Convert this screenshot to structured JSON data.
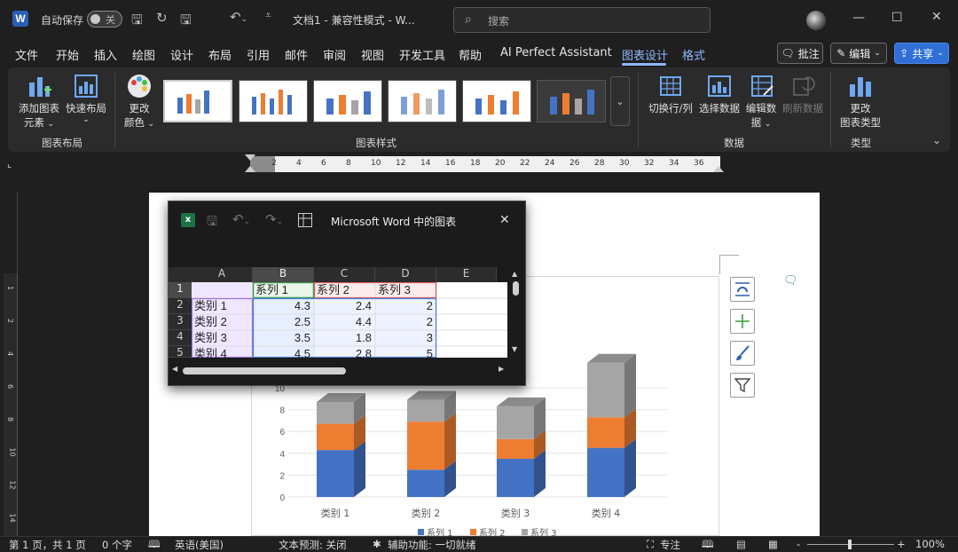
{
  "titlebar": {
    "autosave_label": "自动保存",
    "autosave_state": "关",
    "doc_title": "文档1",
    "separator": "-",
    "mode": "兼容性模式",
    "separator2": "-",
    "app": "W...",
    "search_placeholder": "搜索"
  },
  "tabs": [
    "文件",
    "开始",
    "插入",
    "绘图",
    "设计",
    "布局",
    "引用",
    "邮件",
    "审阅",
    "视图",
    "开发工具",
    "帮助",
    "AI Perfect Assistant",
    "图表设计",
    "格式"
  ],
  "right_buttons": {
    "comment": "批注",
    "edit": "编辑",
    "share": "共享"
  },
  "ribbon": {
    "add_element": [
      "添加图表",
      "元素"
    ],
    "quick_layout": "快速布局",
    "group_layout": "图表布局",
    "change_color": [
      "更改",
      "颜色"
    ],
    "group_styles": "图表样式",
    "switch_row_col": "切换行/列",
    "select_data": "选择数据",
    "edit_data": [
      "编辑数",
      "据"
    ],
    "refresh_data": "刷新数据",
    "group_data": "数据",
    "change_type": [
      "更改",
      "图表类型"
    ],
    "group_type": "类型"
  },
  "ruler_numbers": [
    "2",
    "4",
    "6",
    "8",
    "10",
    "12",
    "14",
    "16",
    "18",
    "20",
    "22",
    "24",
    "26",
    "28",
    "30",
    "32",
    "34",
    "36"
  ],
  "vruler_numbers": [
    "1",
    "2",
    "4",
    "6",
    "8",
    "10",
    "12",
    "14"
  ],
  "excel": {
    "title": "Microsoft Word 中的图表",
    "columns": [
      "A",
      "B",
      "C",
      "D",
      "E"
    ],
    "rows": [
      "1",
      "2",
      "3",
      "4",
      "5"
    ],
    "header_row": [
      "",
      "系列 1",
      "系列 2",
      "系列 3"
    ],
    "data": [
      [
        "类别 1",
        "4.3",
        "2.4",
        "2"
      ],
      [
        "类别 2",
        "2.5",
        "4.4",
        "2"
      ],
      [
        "类别 3",
        "3.5",
        "1.8",
        "3"
      ],
      [
        "类别 4",
        "4.5",
        "2.8",
        "5"
      ]
    ]
  },
  "chart_data": {
    "type": "bar",
    "stacked": true,
    "categories": [
      "类别 1",
      "类别 2",
      "类别 3",
      "类别 4"
    ],
    "series": [
      {
        "name": "系列 1",
        "values": [
          4.3,
          2.5,
          3.5,
          4.5
        ],
        "color": "#4472c4"
      },
      {
        "name": "系列 2",
        "values": [
          2.4,
          4.4,
          1.8,
          2.8
        ],
        "color": "#ed7d31"
      },
      {
        "name": "系列 3",
        "values": [
          2,
          2,
          3,
          5
        ],
        "color": "#a5a5a5"
      }
    ],
    "yticks": [
      "0",
      "2",
      "4",
      "6",
      "8",
      "10"
    ],
    "ylim": [
      0,
      12
    ],
    "legend": "bottom"
  },
  "status": {
    "page": "第 1 页，共 1 页",
    "words": "0 个字",
    "language": "英语(美国)",
    "prediction": "文本预测: 关闭",
    "accessibility": "辅助功能: 一切就绪",
    "focus": "专注",
    "zoom": "100%",
    "minus": "-",
    "plus": "+"
  },
  "colors": {
    "accent": "#8fb8ff",
    "share": "#2f6fd6"
  }
}
